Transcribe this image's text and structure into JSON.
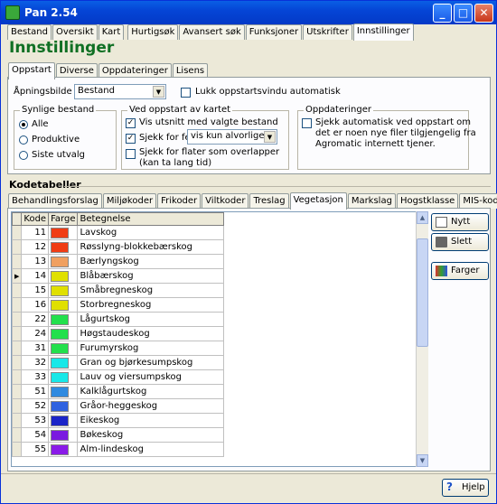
{
  "window": {
    "title": "Pan 2.54"
  },
  "main_tabs": [
    "Bestand",
    "Oversikt",
    "Kart",
    "Hurtigsøk",
    "Avansert søk",
    "Funksjoner",
    "Utskrifter",
    "Innstillinger"
  ],
  "heading": "Innstillinger",
  "sub_tabs": [
    "Oppstart",
    "Diverse",
    "Oppdateringer",
    "Lisens"
  ],
  "startup": {
    "opening_label": "Åpningsbilde",
    "opening_value": "Bestand",
    "close_startup_label": "Lukk oppstartsvindu automatisk",
    "visible_title": "Synlige bestand",
    "radio_alle": "Alle",
    "radio_prod": "Produktive",
    "radio_siste": "Siste utvalg",
    "map_title": "Ved oppstart av kartet",
    "vis_utsnitt": "Vis utsnitt med valgte bestand",
    "sjekk_feil": "Sjekk for feil",
    "feil_value": "vis kun alvorlige",
    "sjekk_flater": "Sjekk for flater som overlapper",
    "sjekk_flater2": "(kan ta lang tid)",
    "upd_title": "Oppdateringer",
    "upd_text1": "Sjekk automatisk ved oppstart om",
    "upd_text2": "det er noen nye filer tilgjengelig fra",
    "upd_text3": "Agromatic internett tjener."
  },
  "codes": {
    "title": "Kodetabeller",
    "tabs": [
      "Behandlingsforslag",
      "Miljøkoder",
      "Frikoder",
      "Viltkoder",
      "Treslag",
      "Vegetasjon",
      "Markslag",
      "Hogstklasse",
      "MIS-koder"
    ],
    "col_kode": "Kode",
    "col_farge": "Farge",
    "col_betegnelse": "Betegnelse",
    "rows": [
      {
        "kode": "11",
        "color": "#f03c14",
        "name": "Lavskog"
      },
      {
        "kode": "12",
        "color": "#f03c14",
        "name": "Røsslyng-blokkebærskog"
      },
      {
        "kode": "13",
        "color": "#f0a060",
        "name": "Bærlyngskog"
      },
      {
        "kode": "14",
        "color": "#e0e000",
        "name": "Blåbærskog"
      },
      {
        "kode": "15",
        "color": "#e0e000",
        "name": "Småbregneskog"
      },
      {
        "kode": "16",
        "color": "#e0e000",
        "name": "Storbregneskog"
      },
      {
        "kode": "22",
        "color": "#22e04c",
        "name": "Lågurtskog"
      },
      {
        "kode": "24",
        "color": "#22e04c",
        "name": "Høgstaudeskog"
      },
      {
        "kode": "31",
        "color": "#22e04c",
        "name": "Furumyrskog"
      },
      {
        "kode": "32",
        "color": "#18e8e8",
        "name": "Gran og bjørkesumpskog"
      },
      {
        "kode": "33",
        "color": "#18e8e8",
        "name": "Lauv og viersumpskog"
      },
      {
        "kode": "51",
        "color": "#2f8ae0",
        "name": "Kalklågurtskog"
      },
      {
        "kode": "52",
        "color": "#2f62e0",
        "name": "Gråor-heggeskog"
      },
      {
        "kode": "53",
        "color": "#1a24c8",
        "name": "Eikeskog"
      },
      {
        "kode": "54",
        "color": "#7a1ae0",
        "name": "Bøkeskog"
      },
      {
        "kode": "55",
        "color": "#8a1ae8",
        "name": "Alm-lindeskog"
      }
    ],
    "btn_nytt": "Nytt",
    "btn_slett": "Slett",
    "btn_farger": "Farger"
  },
  "help": "Hjelp"
}
